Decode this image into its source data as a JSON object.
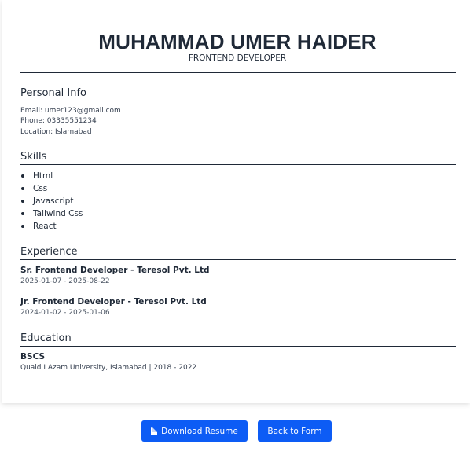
{
  "header": {
    "name": "MUHAMMAD UMER HAIDER",
    "role": "FRONTEND DEVELOPER"
  },
  "personal_info": {
    "title": "Personal Info",
    "email": "Email: umer123@gmail.com",
    "phone": "Phone: 03335551234",
    "location": "Location: Islamabad"
  },
  "skills": {
    "title": "Skills",
    "items": [
      "Html",
      "Css",
      "Javascript",
      "Tailwind Css",
      "React"
    ]
  },
  "experience": {
    "title": "Experience",
    "items": [
      {
        "role": "Sr. Frontend Developer - Teresol Pvt. Ltd",
        "dates": "2025-01-07 - 2025-08-22"
      },
      {
        "role": "Jr. Frontend Developer - Teresol Pvt. Ltd",
        "dates": "2024-01-02 - 2025-01-06"
      }
    ]
  },
  "education": {
    "title": "Education",
    "degree": "BSCS",
    "details": "Quaid I Azam University, Islamabad | 2018 - 2022"
  },
  "actions": {
    "download_label": "Download Resume",
    "download_icon": "document-icon",
    "back_label": "Back to Form",
    "button_color": "#0d5cf5"
  }
}
